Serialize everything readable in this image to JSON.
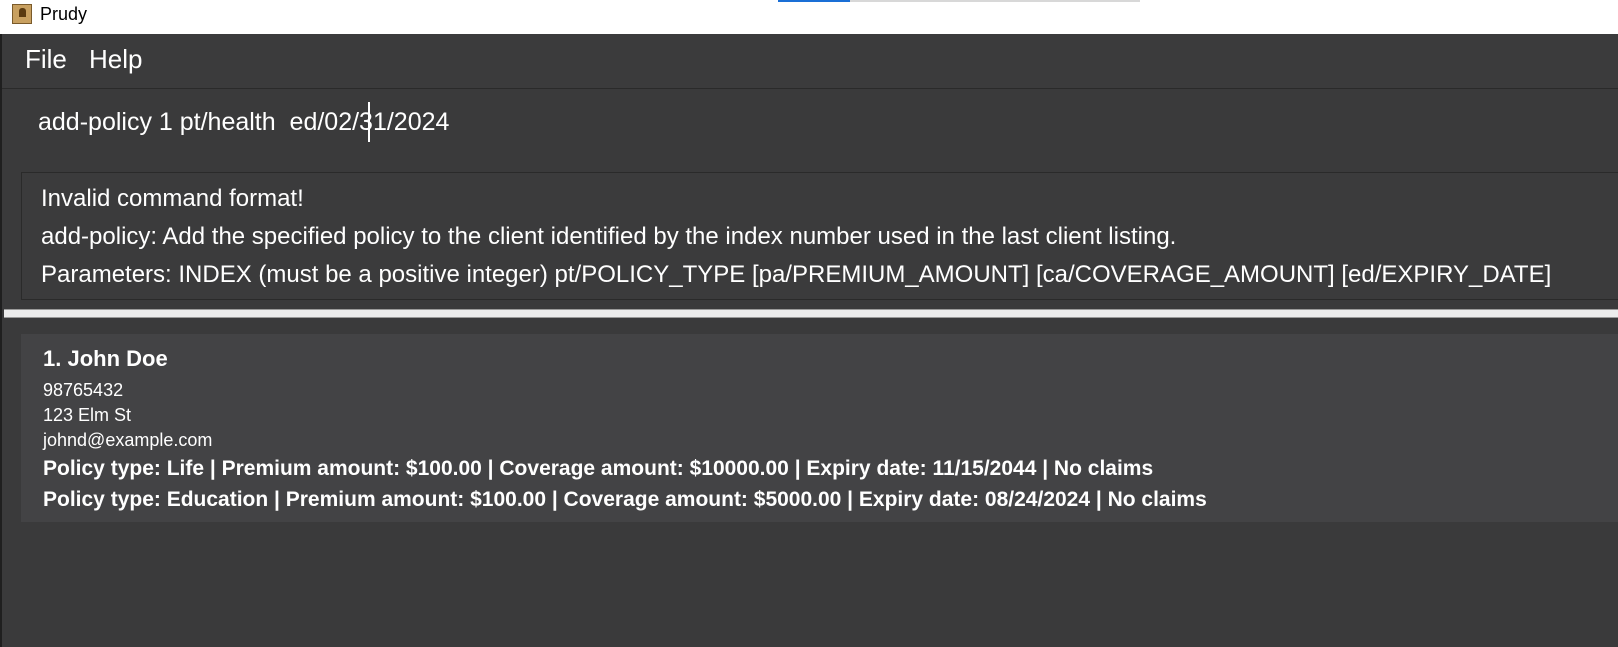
{
  "window": {
    "title": "Prudy",
    "icon": "app-person-icon"
  },
  "menu": {
    "items": [
      {
        "label": "File"
      },
      {
        "label": "Help"
      }
    ]
  },
  "command": {
    "value": "add-policy 1 pt/health  ed/02/31/2024"
  },
  "result": {
    "lines": [
      "Invalid command format!",
      "add-policy: Add the specified policy to the client identified by the index number used in the last client listing.",
      "Parameters: INDEX (must be a positive integer) pt/POLICY_TYPE [pa/PREMIUM_AMOUNT] [ca/COVERAGE_AMOUNT] [ed/EXPIRY_DATE]"
    ]
  },
  "clients": [
    {
      "index_name": "1. John Doe",
      "phone": "98765432",
      "address": "123 Elm St",
      "email": "johnd@example.com",
      "policies": [
        "Policy type: Life | Premium amount: $100.00 | Coverage amount: $10000.00 | Expiry date: 11/15/2044 | No claims",
        "Policy type: Education | Premium amount: $100.00 | Coverage amount: $5000.00 | Expiry date: 08/24/2024 | No claims"
      ]
    }
  ],
  "colors": {
    "background": "#3a3a3b",
    "card": "#434345",
    "text": "#ffffff"
  }
}
